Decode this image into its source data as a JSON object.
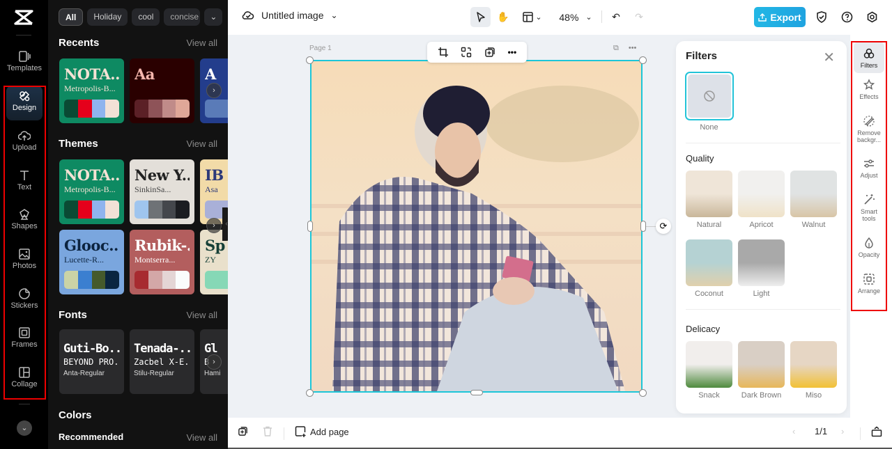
{
  "app": {
    "logo": "capcut-logo"
  },
  "rail": {
    "items": [
      {
        "id": "templates",
        "label": "Templates",
        "icon": "templates-icon"
      },
      {
        "id": "design",
        "label": "Design",
        "icon": "design-icon",
        "active": true
      },
      {
        "id": "upload",
        "label": "Upload",
        "icon": "upload-icon"
      },
      {
        "id": "text",
        "label": "Text",
        "icon": "text-icon"
      },
      {
        "id": "shapes",
        "label": "Shapes",
        "icon": "shapes-icon"
      },
      {
        "id": "photos",
        "label": "Photos",
        "icon": "photos-icon"
      },
      {
        "id": "stickers",
        "label": "Stickers",
        "icon": "stickers-icon"
      },
      {
        "id": "frames",
        "label": "Frames",
        "icon": "frames-icon"
      },
      {
        "id": "collage",
        "label": "Collage",
        "icon": "collage-icon"
      }
    ],
    "more_glyph": "⌄"
  },
  "panel": {
    "chips": [
      "All",
      "Holiday",
      "cool",
      "concise"
    ],
    "chips_more": "⌄",
    "recents": {
      "title": "Recents",
      "view_all": "View all",
      "cards": [
        {
          "t1": "NOTA...",
          "t2": "Metropolis-B...",
          "bg": "#0e8a62",
          "c1": "#f4e2d4",
          "c2": "#f4e2d4",
          "swatches": [
            "#0a4a34",
            "#e5001b",
            "#8fb4ee",
            "#f2e1d6"
          ]
        },
        {
          "t1": "Aa",
          "t2": "",
          "bg": "#2a0000",
          "c1": "#f6b7ae",
          "c2": "#f6b7ae",
          "swatches": [
            "#5b2026",
            "#8e5358",
            "#c08b89",
            "#dfa798"
          ]
        },
        {
          "t1": "A",
          "t2": "",
          "bg": "#233d8c",
          "c1": "#ffffff",
          "c2": "#ffffff",
          "swatches": [
            "#5a7bb8"
          ]
        }
      ]
    },
    "themes": {
      "title": "Themes",
      "view_all": "View all",
      "cards": [
        {
          "t1": "NOTA...",
          "t2": "Metropolis-B...",
          "bg": "#0e8a62",
          "c1": "#f4e2d4",
          "c2": "#f4e2d4",
          "swatches": [
            "#0a4a34",
            "#e5001b",
            "#8fb4ee",
            "#f2e1d6"
          ]
        },
        {
          "t1": "New Y...",
          "t2": "SinkinSa...",
          "bg": "#e3dfd9",
          "c1": "#222222",
          "c2": "#444444",
          "swatches": [
            "#9fc5ee",
            "#6e7276",
            "#44474c",
            "#1b1d21"
          ]
        },
        {
          "t1": "IB",
          "t2": "Asa",
          "bg": "#f2dba8",
          "c1": "#2d3a7a",
          "c2": "#2d3a7a",
          "swatches": [
            "#a9b0d8"
          ]
        },
        {
          "t1": "Glooc...",
          "t2": "Lucette-R...",
          "bg": "#7aa6de",
          "c1": "#0c2440",
          "c2": "#0c2440",
          "swatches": [
            "#cbd3a6",
            "#3b7fd0",
            "#455a2c",
            "#0a2540"
          ]
        },
        {
          "t1": "Rubik-...",
          "t2": "Montserra...",
          "bg": "#b35e5e",
          "c1": "#ffffff",
          "c2": "#ffffff",
          "swatches": [
            "#a72b30",
            "#d3a7a7",
            "#e4d5d5",
            "#fafcfc"
          ]
        },
        {
          "t1": "Sp",
          "t2": "ZY",
          "bg": "#e9e0cb",
          "c1": "#153f37",
          "c2": "#153f37",
          "swatches": [
            "#86d8b6"
          ]
        }
      ]
    },
    "fonts": {
      "title": "Fonts",
      "view_all": "View all",
      "cards": [
        {
          "f1": "Guti-Bo...",
          "f2": "BEYOND PRO...",
          "f3": "Anta-Regular"
        },
        {
          "f1": "Tenada-...",
          "f2": "Zacbel X-E...",
          "f3": "Stilu-Regular"
        },
        {
          "f1": "Gl",
          "f2": "B",
          "f3": "Hami"
        }
      ]
    },
    "colors": {
      "title": "Colors",
      "recommended": "Recommended",
      "view_all": "View all"
    }
  },
  "topbar": {
    "title": "Untitled image",
    "zoom": "48%",
    "export_label": "Export",
    "accent": "#1fa8e2"
  },
  "canvas": {
    "page_label": "Page 1",
    "context_tools": [
      "crop-icon",
      "replace-icon",
      "duplicate-icon",
      "more-icon"
    ]
  },
  "filters": {
    "title": "Filters",
    "none_label": "None",
    "sections": [
      {
        "title": "Quality",
        "items": [
          {
            "label": "Natural",
            "colors": [
              "#efe5d8",
              "#c9b79a"
            ]
          },
          {
            "label": "Apricot",
            "colors": [
              "#f1f0ee",
              "#efe2c8"
            ]
          },
          {
            "label": "Walnut",
            "colors": [
              "#e0e3e3",
              "#d8c5a6"
            ]
          },
          {
            "label": "Coconut",
            "colors": [
              "#b5d2d3",
              "#e0d0ac"
            ]
          },
          {
            "label": "Light",
            "colors": [
              "#a9a9a9",
              "#eeeeee"
            ]
          }
        ]
      },
      {
        "title": "Delicacy",
        "items": [
          {
            "label": "Snack",
            "colors": [
              "#f1eeec",
              "#4f8a3e"
            ]
          },
          {
            "label": "Dark Brown",
            "colors": [
              "#d9cfc5",
              "#e7b75a"
            ]
          },
          {
            "label": "Miso",
            "colors": [
              "#e6d6c4",
              "#f2c135"
            ]
          }
        ]
      }
    ]
  },
  "tools": [
    {
      "label": "Filters",
      "icon": "filters-icon",
      "active": true
    },
    {
      "label": "Effects",
      "icon": "effects-icon"
    },
    {
      "label": "Remove backgr...",
      "icon": "remove-background-icon"
    },
    {
      "label": "Adjust",
      "icon": "adjust-icon"
    },
    {
      "label": "Smart tools",
      "icon": "smart-tools-icon"
    },
    {
      "label": "Opacity",
      "icon": "opacity-icon"
    },
    {
      "label": "Arrange",
      "icon": "arrange-icon"
    }
  ],
  "bottombar": {
    "add_page": "Add page",
    "page_indicator": "1/1"
  }
}
